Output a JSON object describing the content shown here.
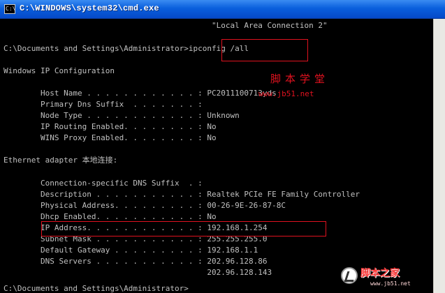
{
  "window": {
    "title": "C:\\WINDOWS\\system32\\cmd.exe",
    "icon": "cmd-icon"
  },
  "console": {
    "lines": [
      "                                             \"Local Area Connection 2\"",
      "",
      "C:\\Documents and Settings\\Administrator>ipconfig /all",
      "",
      "Windows IP Configuration",
      "",
      "        Host Name . . . . . . . . . . . . : PC2011100713yds",
      "        Primary Dns Suffix  . . . . . . . :",
      "        Node Type . . . . . . . . . . . . : Unknown",
      "        IP Routing Enabled. . . . . . . . : No",
      "        WINS Proxy Enabled. . . . . . . . : No",
      "",
      "Ethernet adapter 本地连接:",
      "",
      "        Connection-specific DNS Suffix  . :",
      "        Description . . . . . . . . . . . : Realtek PCIe FE Family Controller",
      "        Physical Address. . . . . . . . . : 00-26-9E-26-87-8C",
      "        Dhcp Enabled. . . . . . . . . . . : No",
      "        IP Address. . . . . . . . . . . . : 192.168.1.254",
      "        Subnet Mask . . . . . . . . . . . : 255.255.255.0",
      "        Default Gateway . . . . . . . . . : 192.168.1.1",
      "        DNS Servers . . . . . . . . . . . : 202.96.128.86",
      "                                            202.96.128.143",
      "C:\\Documents and Settings\\Administrator>"
    ]
  },
  "watermark": {
    "top_text": "脚本学堂",
    "top_url": "www.jb51.net",
    "bottom_text": "脚本之家",
    "bottom_url": "www.jb51.net"
  },
  "colors": {
    "console_text": "#c0c0c0",
    "highlight": "#e0121f",
    "titlebar": "#0a5fdd"
  }
}
